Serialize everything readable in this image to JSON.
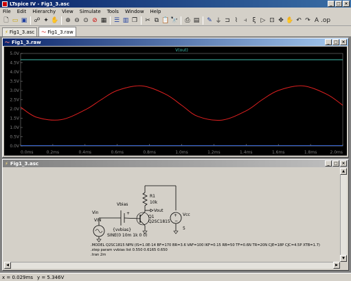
{
  "app": {
    "title": "LTspice IV - Fig1_3.asc"
  },
  "menu": [
    "File",
    "Edit",
    "Hierarchy",
    "View",
    "Simulate",
    "Tools",
    "Window",
    "Help"
  ],
  "toolbar": [
    "new-icon",
    "open-icon",
    "save-icon",
    "control-panel-icon",
    "run-icon",
    "halt-icon",
    "zoom-in-icon",
    "zoom-out-icon",
    "zoom-fit-icon",
    "zoom-back-icon",
    "pan-icon",
    "tile-horizontal-icon",
    "tile-vertical-icon",
    "cascade-icon",
    "close-icon",
    "cut-icon",
    "copy-icon",
    "paste-icon",
    "find-icon",
    "print-icon",
    "print-preview-icon",
    "wire-icon",
    "ground-icon",
    "label-icon",
    "resistor-icon",
    "capacitor-icon",
    "inductor-icon",
    "diode-icon",
    "component-icon",
    "move-icon",
    "drag-icon",
    "undo-icon",
    "redo-icon",
    "text-icon",
    "spice-directive-icon"
  ],
  "tabs": [
    {
      "label": "Fig1_3.asc",
      "active": false
    },
    {
      "label": "Fig1_3.raw",
      "active": true
    }
  ],
  "waveform": {
    "title": "Fig1_3.raw",
    "trace_label": "V(out)",
    "colors": {
      "bg": "#000000",
      "trace1": "#3fbfaf",
      "trace2": "#e02020",
      "grid": "#303030",
      "axis": "#808080",
      "label": "#808080"
    }
  },
  "chart_data": {
    "type": "line",
    "xlabel": "",
    "ylabel": "",
    "xlim": [
      0,
      2.0
    ],
    "ylim": [
      0,
      5.0
    ],
    "x_ticks": [
      "0.0ms",
      "0.2ms",
      "0.4ms",
      "0.6ms",
      "0.8ms",
      "1.0ms",
      "1.2ms",
      "1.4ms",
      "1.6ms",
      "1.8ms",
      "2.0ms"
    ],
    "y_ticks": [
      "0.0V",
      "0.5V",
      "1.0V",
      "1.5V",
      "2.0V",
      "2.5V",
      "3.0V",
      "3.5V",
      "4.0V",
      "4.5V",
      "5.0V"
    ],
    "series": [
      {
        "name": "V(out)",
        "x": [
          0,
          0.2,
          0.4,
          0.6,
          0.8,
          1.0,
          1.2,
          1.4,
          1.6,
          1.8,
          2.0
        ],
        "values": [
          4.66,
          4.66,
          4.66,
          4.66,
          4.66,
          4.66,
          4.66,
          4.66,
          4.66,
          4.66,
          4.66
        ],
        "color": "#3fbfaf"
      },
      {
        "x": [
          0,
          0.1,
          0.25,
          0.4,
          0.5,
          0.6,
          0.75,
          0.9,
          1.0,
          1.1,
          1.25,
          1.4,
          1.5,
          1.6,
          1.75,
          1.9,
          2.0
        ],
        "values": [
          2.1,
          1.55,
          1.42,
          1.95,
          2.5,
          3.0,
          3.25,
          2.8,
          2.2,
          1.6,
          1.4,
          1.9,
          2.5,
          3.0,
          3.25,
          2.8,
          2.2
        ],
        "color": "#e02020"
      },
      {
        "x": [
          0,
          2.0
        ],
        "values": [
          0.02,
          0.02
        ],
        "color": "#3f6fdf"
      }
    ]
  },
  "schematic": {
    "title": "Fig1_3.asc",
    "components": {
      "r1": {
        "name": "R1",
        "value": "10k"
      },
      "q1": {
        "name": "Q1",
        "value": "Q2SC1815"
      },
      "vcc": {
        "name": "Vcc",
        "value": "5"
      },
      "vin": {
        "name": "VIN",
        "value": "SINE(0 10m 1k 0 0)"
      },
      "vbias": {
        "name": "Vbias",
        "value": "{vvbias}"
      }
    },
    "net_labels": {
      "vout": "Vout",
      "vin": "Vin"
    },
    "directives": [
      ".MODEL Q2SC1815 NPN (IS=1.0E-14 BF=170 BR=3.6 VAF=100 IKF=0.15 RB=50 TF=0.6N TR=20N CJE=18P CJC=4.5P XTB=1.7)",
      ".step param vvbias list 0.550 0.6165 0.650",
      ".tran 2m"
    ]
  },
  "statusbar": {
    "x_readout": "x = 0.029ms",
    "y_readout": "y = 5.346V"
  }
}
